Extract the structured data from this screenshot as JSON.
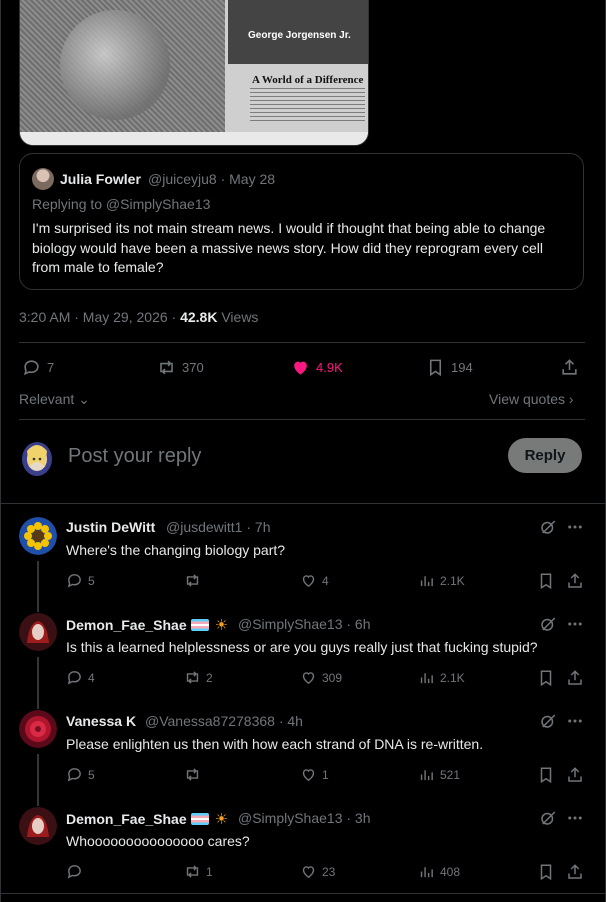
{
  "media": {
    "caption_name": "George Jorgensen Jr.",
    "article_title": "A World of a Difference"
  },
  "quote": {
    "name": "Julia Fowler",
    "handle_time": "@juiceyju8 · May 28",
    "replying_to": "Replying to @SimplyShae13",
    "text": "I'm surprised its not main stream news. I would if thought that being able to change biology would have been a massive news story. How did they reprogram every cell from male to female?"
  },
  "post_meta": {
    "time": "3:20 AM · May 29, 2026 · ",
    "views_count": "42.8K",
    "views_label": " Views"
  },
  "actions": {
    "replies": "7",
    "reposts": "370",
    "likes": "4.9K",
    "bookmarks": "194"
  },
  "sort": {
    "relevant": "Relevant",
    "view_quotes": "View quotes"
  },
  "composer": {
    "placeholder": "Post your reply",
    "button": "Reply"
  },
  "colors": {
    "like": "#f91880",
    "muted": "#71767b",
    "text": "#e7e9ea",
    "border": "#2f3336"
  },
  "replies": [
    {
      "name": "Justin DeWitt",
      "handle_time": "@jusdewitt1 · 7h",
      "text": "Where's the changing biology part?",
      "replies": "5",
      "reposts": "",
      "likes": "4",
      "views": "2.1K"
    },
    {
      "name": "Demon_Fae_Shae",
      "handle_time": "@SimplyShae13 · 6h",
      "text": "Is this a learned helplessness or are you guys really just that fucking stupid?",
      "replies": "4",
      "reposts": "2",
      "likes": "309",
      "views": "2.1K"
    },
    {
      "name": "Vanessa K",
      "handle_time": "@Vanessa87278368 · 4h",
      "text": "Please enlighten us then with how each strand of DNA is re-written.",
      "replies": "5",
      "reposts": "",
      "likes": "1",
      "views": "521"
    },
    {
      "name": "Demon_Fae_Shae",
      "handle_time": "@SimplyShae13 · 3h",
      "text": "Whooooooooooooooo cares?",
      "replies": "",
      "reposts": "1",
      "likes": "23",
      "views": "408"
    }
  ]
}
